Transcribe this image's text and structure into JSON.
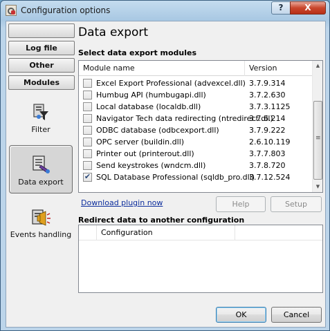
{
  "window": {
    "title": "Configuration options",
    "help_label": "?",
    "close_label": "X"
  },
  "sidebar": {
    "buttons": [
      {
        "label": ""
      },
      {
        "label": "Log file"
      },
      {
        "label": "Other"
      },
      {
        "label": "Modules"
      }
    ],
    "items": [
      {
        "label": "Filter",
        "icon": "filter-icon",
        "selected": false
      },
      {
        "label": "Data export",
        "icon": "data-export-icon",
        "selected": true
      },
      {
        "label": "Events handling",
        "icon": "events-handling-icon",
        "selected": false
      }
    ]
  },
  "main": {
    "heading": "Data export",
    "modules_title": "Select data export modules",
    "columns": [
      "Module name",
      "Version"
    ],
    "modules": [
      {
        "name": "Excel Export Professional (advexcel.dll)",
        "version": "3.7.9.314",
        "checked": false
      },
      {
        "name": "Humbug API (humbugapi.dll)",
        "version": "3.7.2.630",
        "checked": false
      },
      {
        "name": "Local database (localdb.dll)",
        "version": "3.7.3.1125",
        "checked": false
      },
      {
        "name": "Navigator Tech data redirecting (ntredirect.dll)",
        "version": "3.7.6.214",
        "checked": false
      },
      {
        "name": "ODBC database (odbcexport.dll)",
        "version": "3.7.9.222",
        "checked": false
      },
      {
        "name": "OPC server (buildin.dll)",
        "version": "2.6.10.119",
        "checked": false
      },
      {
        "name": "Printer out (printerout.dll)",
        "version": "3.7.7.803",
        "checked": false
      },
      {
        "name": "Send keystrokes (wndcm.dll)",
        "version": "3.7.8.720",
        "checked": false
      },
      {
        "name": "SQL Database Professional (sqldb_pro.dll)",
        "version": "3.7.12.524",
        "checked": true
      }
    ],
    "download_link": "Download plugin now",
    "help_button": "Help",
    "setup_button": "Setup",
    "redirect_title": "Redirect data to another configuration",
    "redirect_columns": [
      "",
      "Configuration"
    ]
  },
  "footer": {
    "ok_label": "OK",
    "cancel_label": "Cancel"
  }
}
